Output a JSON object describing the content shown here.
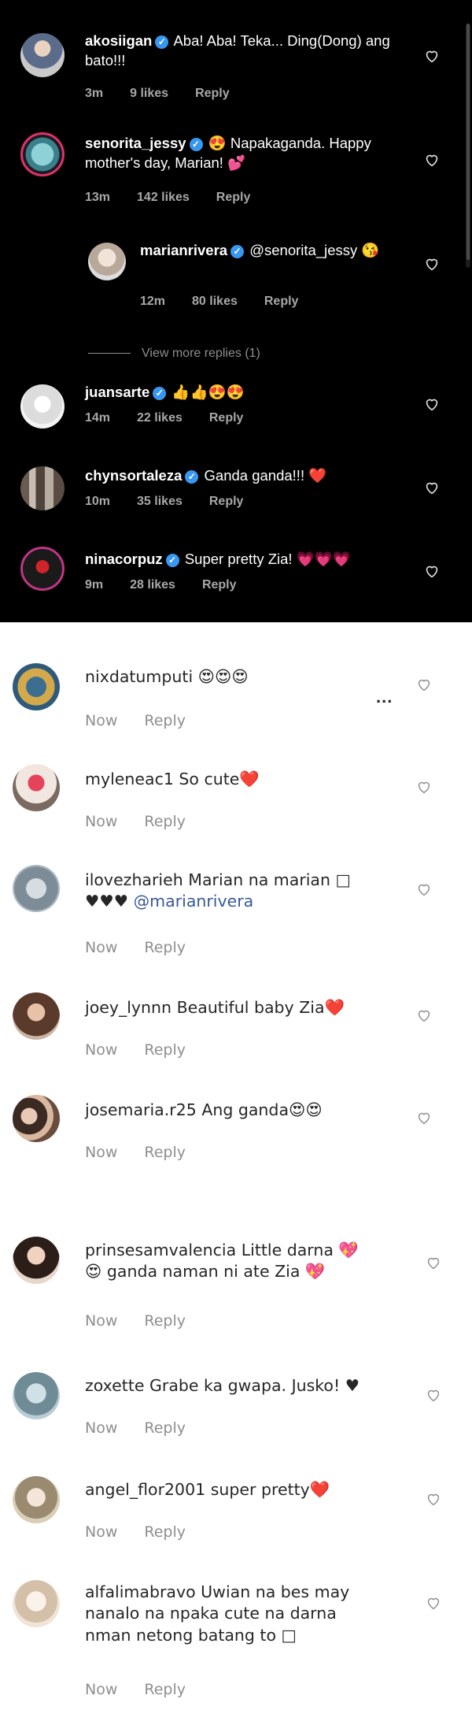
{
  "dark_comments": [
    {
      "username": "akosiigan",
      "verified": true,
      "text": "Aba! Aba! Teka... Ding(Dong) ang bato!!!",
      "time": "3m",
      "likes": "9 likes",
      "reply": "Reply"
    },
    {
      "username": "senorita_jessy",
      "verified": true,
      "text": "😍 Napakaganda. Happy mother's day, Marian! 💕",
      "time": "13m",
      "likes": "142 likes",
      "reply": "Reply"
    },
    {
      "username": "marianrivera",
      "verified": true,
      "text": "@senorita_jessy 😘",
      "time": "12m",
      "likes": "80 likes",
      "reply": "Reply"
    },
    {
      "username": "juansarte",
      "verified": true,
      "text": "👍👍😍😍",
      "time": "14m",
      "likes": "22 likes",
      "reply": "Reply"
    },
    {
      "username": "chynsortaleza",
      "verified": true,
      "text": "Ganda ganda!!! ❤️",
      "time": "10m",
      "likes": "35 likes",
      "reply": "Reply"
    },
    {
      "username": "ninacorpuz",
      "verified": true,
      "text": "Super pretty Zia! 💗💗💗",
      "time": "9m",
      "likes": "28 likes",
      "reply": "Reply"
    }
  ],
  "view_more_replies": "View more replies (1)",
  "light_comments": [
    {
      "username": "nixdatumputi",
      "text": "😍😍😍",
      "time": "Now",
      "reply": "Reply"
    },
    {
      "username": "myleneac1",
      "text": "So cute❤️",
      "time": "Now",
      "reply": "Reply"
    },
    {
      "username": "ilovezharieh",
      "text": "Marian na marian □",
      "line2": "♥♥♥",
      "mention": "@marianrivera",
      "time": "Now",
      "reply": "Reply"
    },
    {
      "username": "joey_lynnn",
      "text": "Beautiful baby Zia❤️",
      "time": "Now",
      "reply": "Reply"
    },
    {
      "username": "josemaria.r25",
      "text": "Ang ganda😍😍",
      "time": "Now",
      "reply": "Reply"
    },
    {
      "username": "prinsesamvalencia",
      "text": "Little darna 💖",
      "line2": "😍 ganda naman ni ate Zia 💖",
      "time": "Now",
      "reply": "Reply"
    },
    {
      "username": "zoxette",
      "text": "Grabe ka gwapa. Jusko! ♥",
      "time": "Now",
      "reply": "Reply"
    },
    {
      "username": "angel_flor2001",
      "text": "super pretty❤️",
      "time": "Now",
      "reply": "Reply"
    },
    {
      "username": "alfalimabravo",
      "text": "Uwian na bes may",
      "line2": "nanalo na npaka cute na darna",
      "line3": "nman netong batang to □",
      "time": "Now",
      "reply": "Reply"
    }
  ],
  "more_options": "...",
  "colors": {
    "dark_bg": "#000000",
    "light_bg": "#ffffff",
    "verified": "#3897f0",
    "mention": "#385898",
    "meta_light": "#8e8e8e",
    "meta_dark": "#a8a8a8"
  }
}
